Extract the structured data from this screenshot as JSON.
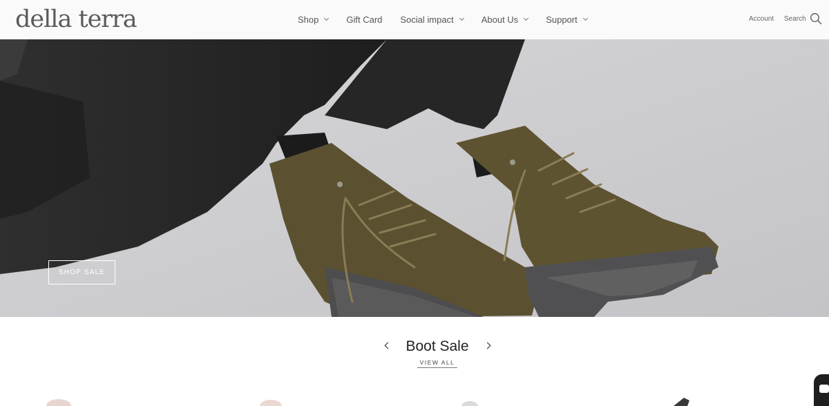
{
  "brand": {
    "logo_text": "della terra"
  },
  "nav": {
    "items": [
      {
        "label": "Shop",
        "has_dropdown": true
      },
      {
        "label": "Gift Card",
        "has_dropdown": false
      },
      {
        "label": "Social impact",
        "has_dropdown": true
      },
      {
        "label": "About Us",
        "has_dropdown": true
      },
      {
        "label": "Support",
        "has_dropdown": true
      }
    ],
    "account_label": "Account",
    "search_label": "Search",
    "search_icon": "magnifier-icon"
  },
  "hero": {
    "cta_label": "SHOP SALE",
    "image": "olive-suede-lace-up-boots"
  },
  "collection": {
    "title": "Boot Sale",
    "view_all_label": "VIEW ALL",
    "prev_icon": "chevron-left-icon",
    "next_icon": "chevron-right-icon"
  },
  "chat": {
    "icon": "chat-bubble-icon"
  },
  "colors": {
    "header_bg": "#fafafa",
    "hero_bg": "#cfcfd2",
    "boot": "#5b5030",
    "sole": "#555555",
    "jeans": "#2a2a2a",
    "text": "#222222"
  }
}
